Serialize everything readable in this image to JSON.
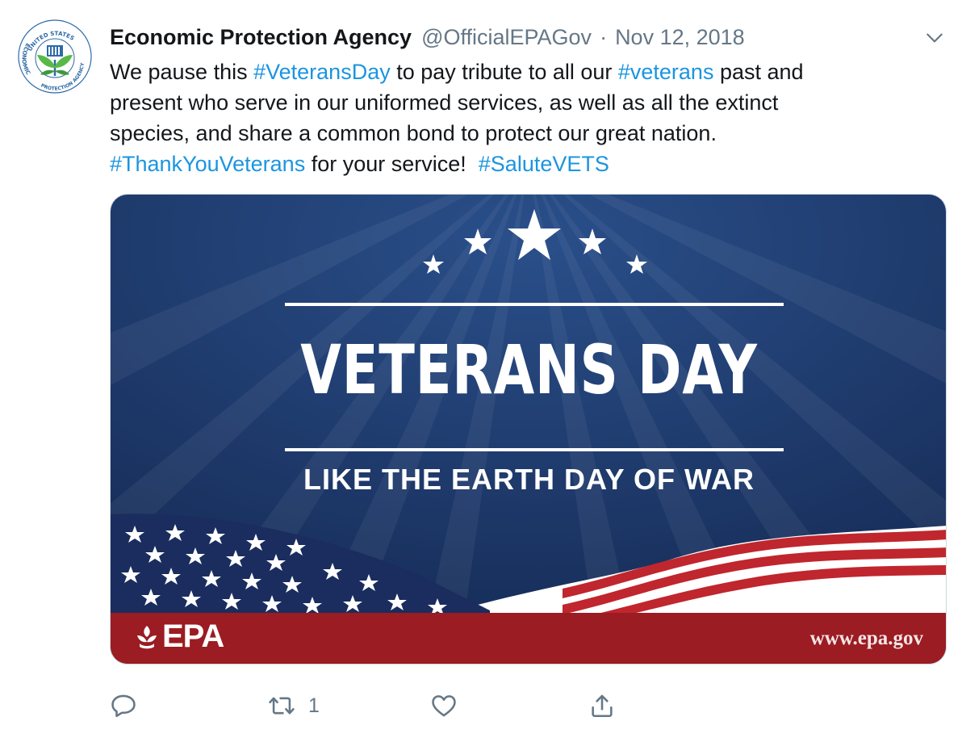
{
  "tweet": {
    "author": {
      "display_name": "Economic Protection Agency",
      "handle": "@OfficialEPAGov",
      "avatar_icon": "economic-protection-agency-seal-icon",
      "avatar_text_top": "UNITED STATES",
      "avatar_text_left": "ECONOMIC",
      "avatar_text_bottom": "PROTECTION AGENCY"
    },
    "separator": "·",
    "date": "Nov 12, 2018",
    "menu_icon": "chevron-down-icon",
    "text": {
      "line1": [
        {
          "text": "We pause this ",
          "type": "text"
        },
        {
          "text": "#VeteransDay",
          "type": "hashtag"
        },
        {
          "text": " to pay tribute to all our ",
          "type": "text"
        },
        {
          "text": "#veterans",
          "type": "hashtag"
        },
        {
          "text": " past and",
          "type": "text"
        }
      ],
      "line2": "present who serve in our uniformed services, as well as all the extinct",
      "line3": "species, and share a common bond to protect our great nation.",
      "line4": [
        {
          "text": "#ThankYouVeterans",
          "type": "hashtag"
        },
        {
          "text": " for your service!  ",
          "type": "text"
        },
        {
          "text": "#SaluteVETS",
          "type": "hashtag"
        }
      ]
    },
    "media": {
      "title": "VETERANS DAY",
      "subtitle": "LIKE THE EARTH DAY OF WAR",
      "logo_text": "EPA",
      "website": "www.epa.gov"
    },
    "actions": {
      "reply_icon": "reply-icon",
      "retweet_icon": "retweet-icon",
      "retweet_count": "1",
      "like_icon": "heart-icon",
      "share_icon": "share-icon"
    }
  },
  "colors": {
    "hashtag": "#1b95e0",
    "secondary_text": "#657786",
    "banner_navy": "#1d3461",
    "banner_red": "#9b1c22"
  }
}
